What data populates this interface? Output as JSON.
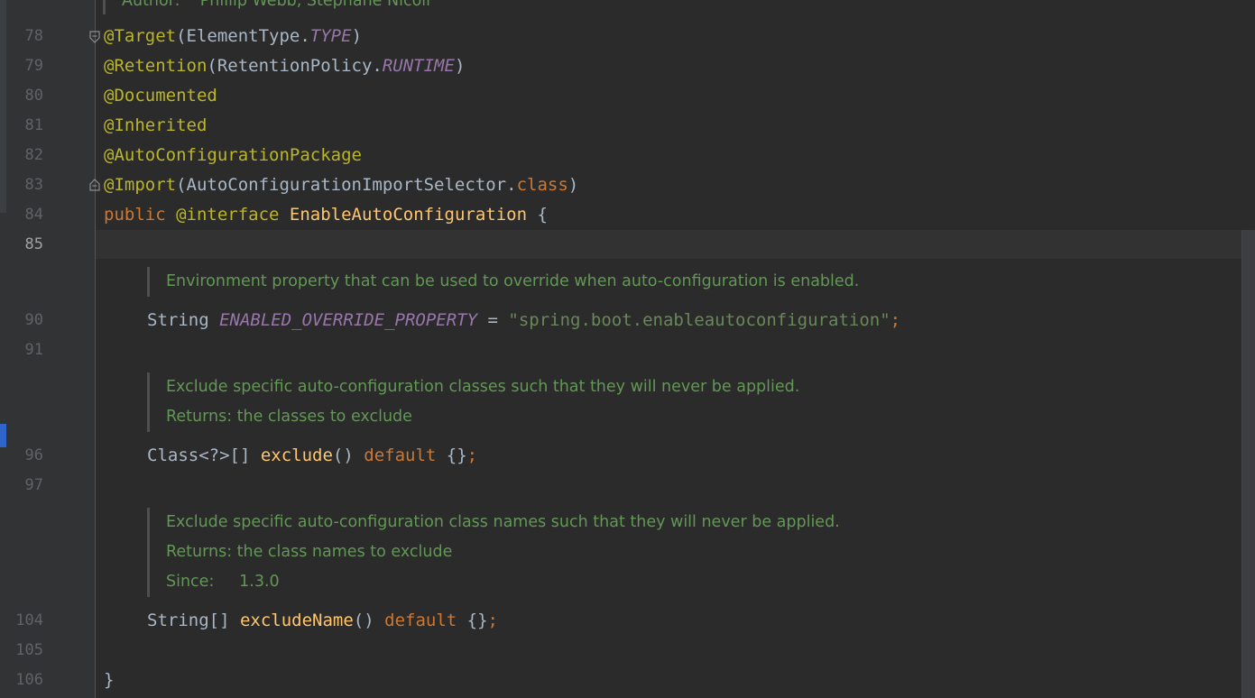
{
  "doc_header": {
    "text": "Author:    Phillip Webb, Stephane Nicoll"
  },
  "gutter": {
    "line_numbers": [
      "78",
      "79",
      "80",
      "81",
      "82",
      "83",
      "84",
      "85",
      "90",
      "91",
      "96",
      "97",
      "104",
      "105",
      "106"
    ]
  },
  "code": {
    "l78": {
      "ann": "@Target",
      "p1": "(ElementType.",
      "const": "TYPE",
      "p2": ")"
    },
    "l79": {
      "ann": "@Retention",
      "p1": "(RetentionPolicy.",
      "const": "RUNTIME",
      "p2": ")"
    },
    "l80": {
      "ann": "@Documented"
    },
    "l81": {
      "ann": "@Inherited"
    },
    "l82": {
      "ann": "@AutoConfigurationPackage"
    },
    "l83": {
      "ann": "@Import",
      "p1": "(AutoConfigurationImportSelector.",
      "kw": "class",
      "p2": ")"
    },
    "l84": {
      "kw1": "public",
      "kw2": "@interface",
      "name": " EnableAutoConfiguration",
      "brace": " {"
    },
    "l90": {
      "type": "String ",
      "const": "ENABLED_OVERRIDE_PROPERTY",
      "eq": " = ",
      "str": "\"spring.boot.enableautoconfiguration\"",
      "semi": ";"
    },
    "l96": {
      "type": "Class<?>[] ",
      "fn": "exclude",
      "parens": "() ",
      "kw": "default",
      "val": " {}",
      "semi": ";"
    },
    "l104": {
      "type": "String[] ",
      "fn": "excludeName",
      "parens": "() ",
      "kw": "default",
      "val": " {}",
      "semi": ";"
    },
    "l106": {
      "brace": "}"
    }
  },
  "docs": {
    "d1": [
      "Environment property that can be used to override when auto-configuration is enabled."
    ],
    "d2": [
      "Exclude specific auto-configuration classes such that they will never be applied.",
      "Returns: the classes to exclude"
    ],
    "d3": [
      "Exclude specific auto-configuration class names such that they will never be applied.",
      "Returns: the class names to exclude",
      "Since:     1.3.0"
    ]
  },
  "colors": {
    "background": "#2b2b2b",
    "annotation": "#bbb529",
    "keyword": "#cc7832",
    "constant": "#9876aa",
    "method": "#ffc66d",
    "string": "#6a8759",
    "doc": "#629755",
    "text": "#a9b7c6"
  },
  "icons": [
    "fold-start-icon",
    "fold-end-icon"
  ]
}
